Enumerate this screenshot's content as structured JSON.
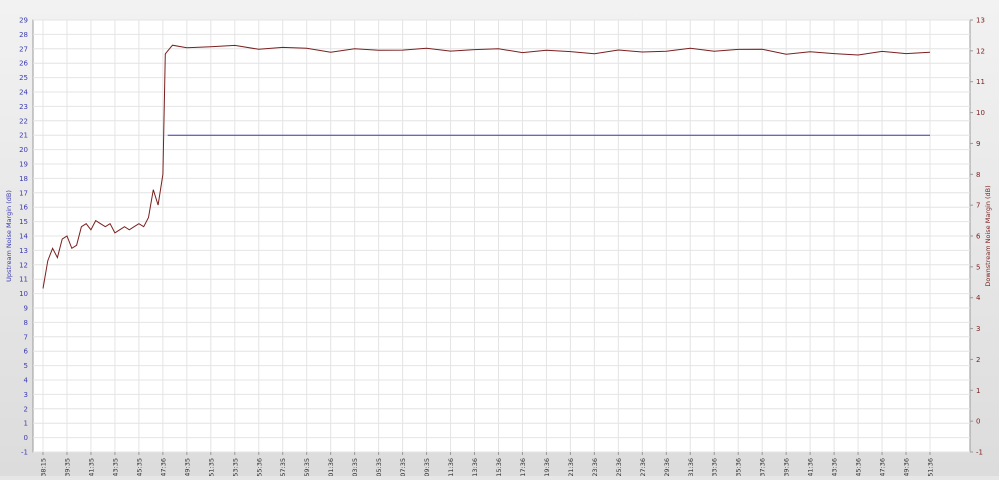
{
  "chart_data": {
    "type": "line",
    "title": "",
    "ylabel_left": "Upstream Noise Margin (dB)",
    "ylabel_right": "Downstream Noise Margin (dB)",
    "ylim_left": [
      -1,
      29
    ],
    "ylim_right": [
      -1,
      13
    ],
    "yticks_left": [
      -1,
      0,
      1,
      2,
      3,
      4,
      5,
      6,
      7,
      8,
      9,
      10,
      11,
      12,
      13,
      14,
      15,
      16,
      17,
      18,
      19,
      20,
      21,
      22,
      23,
      24,
      25,
      26,
      27,
      28,
      29
    ],
    "yticks_right": [
      -1,
      0,
      1,
      2,
      3,
      4,
      5,
      6,
      7,
      8,
      9,
      10,
      11,
      12,
      13
    ],
    "x_ticks": [
      "08:38:15",
      "08:39:35",
      "08:41:35",
      "08:43:35",
      "08:45:35",
      "08:47:36",
      "08:49:35",
      "08:51:35",
      "08:53:35",
      "08:55:36",
      "08:57:35",
      "08:59:35",
      "09:01:36",
      "09:03:35",
      "09:05:35",
      "09:07:35",
      "09:09:35",
      "09:11:36",
      "09:13:36",
      "09:15:36",
      "09:17:36",
      "09:19:36",
      "09:21:36",
      "09:23:36",
      "09:25:36",
      "09:27:36",
      "09:29:36",
      "09:31:36",
      "09:33:36",
      "09:35:36",
      "09:37:36",
      "09:39:36",
      "09:41:36",
      "09:43:36",
      "09:45:36",
      "09:47:36",
      "09:49:36",
      "09:51:36"
    ],
    "grid": true,
    "series": [
      {
        "axis": "right",
        "color": "#7a1f1f",
        "points": [
          [
            0,
            4.3
          ],
          [
            0.2,
            5.2
          ],
          [
            0.4,
            5.6
          ],
          [
            0.6,
            5.3
          ],
          [
            0.8,
            5.9
          ],
          [
            1.0,
            6.0
          ],
          [
            1.2,
            5.6
          ],
          [
            1.4,
            5.7
          ],
          [
            1.6,
            6.3
          ],
          [
            1.8,
            6.4
          ],
          [
            2.0,
            6.2
          ],
          [
            2.2,
            6.5
          ],
          [
            2.4,
            6.4
          ],
          [
            2.6,
            6.3
          ],
          [
            2.8,
            6.4
          ],
          [
            3.0,
            6.1
          ],
          [
            3.2,
            6.2
          ],
          [
            3.4,
            6.3
          ],
          [
            3.6,
            6.2
          ],
          [
            3.8,
            6.3
          ],
          [
            4.0,
            6.4
          ],
          [
            4.2,
            6.3
          ],
          [
            4.4,
            6.6
          ],
          [
            4.6,
            7.5
          ],
          [
            4.8,
            7.0
          ],
          [
            5.0,
            8.0
          ],
          [
            5.1,
            11.9
          ],
          [
            5.2,
            12.0
          ],
          [
            5.4,
            12.1
          ],
          [
            6,
            12.1
          ],
          [
            7,
            12.1
          ],
          [
            8,
            12.1
          ],
          [
            9,
            12.1
          ],
          [
            10,
            12.1
          ],
          [
            11,
            12.1
          ],
          [
            12,
            12.05
          ],
          [
            13,
            12.05
          ],
          [
            14,
            12.05
          ],
          [
            15,
            12.05
          ],
          [
            16,
            12.0
          ],
          [
            17,
            12.0
          ],
          [
            18,
            12.0
          ],
          [
            19,
            12.0
          ],
          [
            20,
            12.0
          ],
          [
            21,
            12.0
          ],
          [
            22,
            12.0
          ],
          [
            23,
            12.0
          ],
          [
            24,
            12.0
          ],
          [
            25,
            12.0
          ],
          [
            26,
            12.0
          ],
          [
            27,
            12.0
          ],
          [
            28,
            12.0
          ],
          [
            29,
            12.0
          ],
          [
            30,
            12.0
          ],
          [
            31,
            11.95
          ],
          [
            32,
            11.95
          ],
          [
            33,
            11.95
          ],
          [
            34,
            11.95
          ],
          [
            35,
            11.95
          ],
          [
            36,
            11.95
          ],
          [
            37,
            11.95
          ]
        ]
      },
      {
        "axis": "left",
        "color": "#3b3bb0",
        "points": [
          [
            5.2,
            21
          ],
          [
            37,
            21
          ]
        ]
      }
    ]
  }
}
